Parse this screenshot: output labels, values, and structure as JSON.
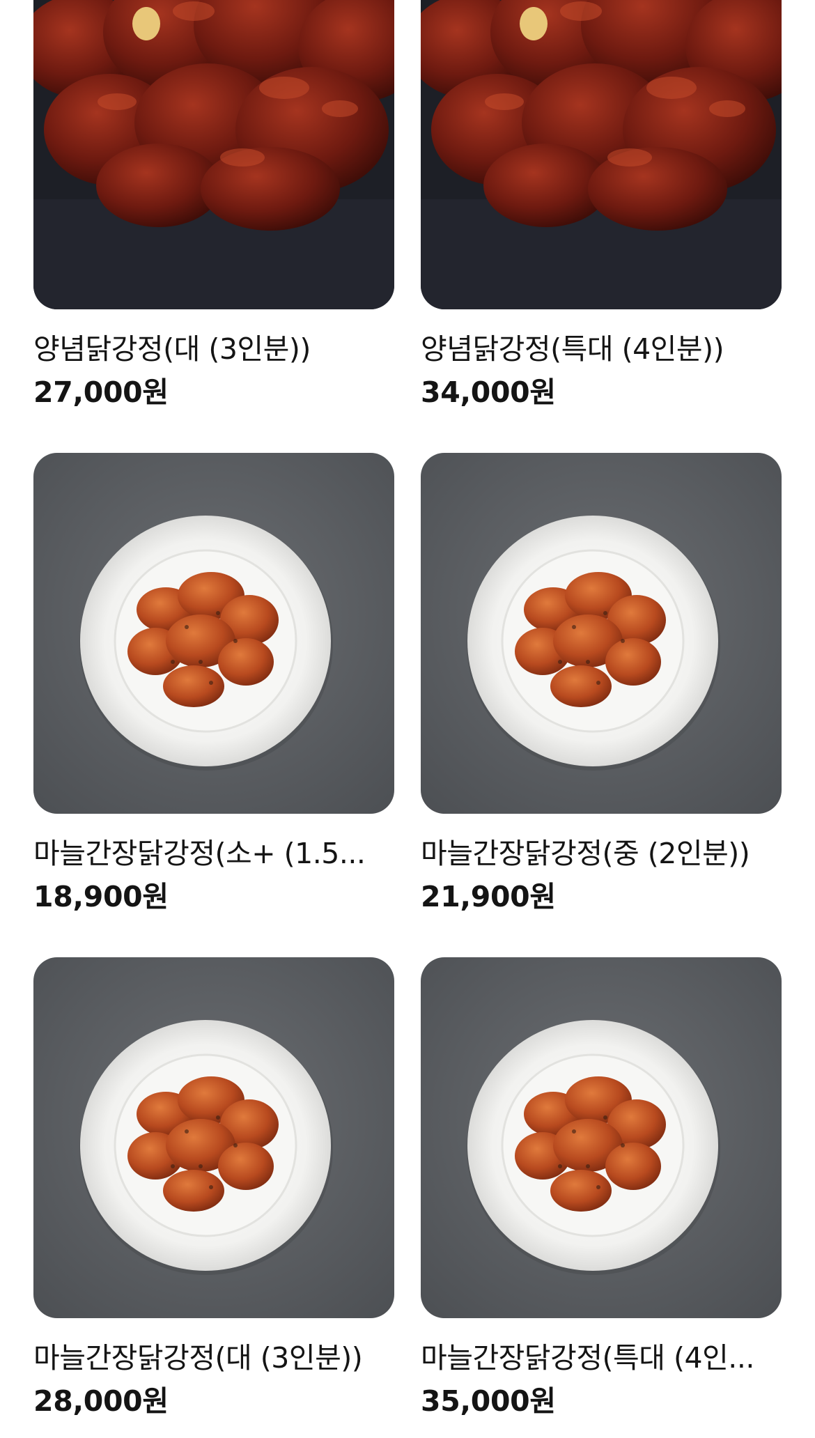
{
  "menu": {
    "items": [
      {
        "name": "양념닭강정(대 (3인분))",
        "price": "27,000원",
        "image": "yangnyeom-chicken"
      },
      {
        "name": "양념닭강정(특대 (4인분))",
        "price": "34,000원",
        "image": "yangnyeom-chicken"
      },
      {
        "name": "마늘간장닭강정(소+ (1.5...",
        "price": "18,900원",
        "image": "garlic-soy-chicken-plate"
      },
      {
        "name": "마늘간장닭강정(중 (2인분))",
        "price": "21,900원",
        "image": "garlic-soy-chicken-plate"
      },
      {
        "name": "마늘간장닭강정(대 (3인분))",
        "price": "28,000원",
        "image": "garlic-soy-chicken-plate"
      },
      {
        "name": "마늘간장닭강정(특대 (4인...",
        "price": "35,000원",
        "image": "garlic-soy-chicken-plate"
      }
    ]
  },
  "colors": {
    "background": "#ffffff",
    "text": "#141414",
    "slate": "#5a5d61"
  }
}
